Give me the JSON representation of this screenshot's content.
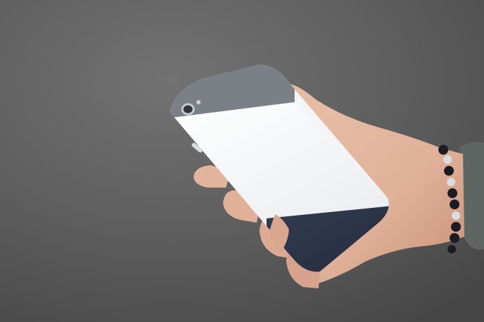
{
  "photo": {
    "subject_icons": [
      "phone-icon",
      "hand-icon",
      "bracelet-icon"
    ],
    "colors": {
      "background": "#595959",
      "background_light": "#6b6b6b",
      "background_dark": "#4a4a4a",
      "case_gray": "#7a7e84",
      "case_white": "#f4f5f7",
      "case_navy": "#2b3245",
      "skin": "#e4b9a2",
      "skin_shadow": "#c98f78",
      "sleeve": "#5f6562",
      "bead_dark": "#1c1a22",
      "bead_clear": "#d9dde2"
    }
  }
}
